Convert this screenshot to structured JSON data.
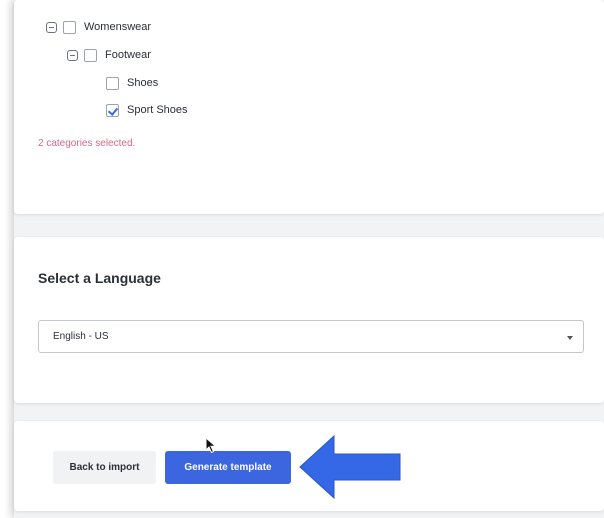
{
  "tree": {
    "items": [
      {
        "label": "Womenswear",
        "checked": false,
        "expandable": true
      },
      {
        "label": "Footwear",
        "checked": false,
        "expandable": true
      },
      {
        "label": "Shoes",
        "checked": false,
        "expandable": false
      },
      {
        "label": "Sport Shoes",
        "checked": true,
        "expandable": false
      }
    ],
    "selected_note": "2 categories selected."
  },
  "language": {
    "title": "Select a Language",
    "selected": "English - US"
  },
  "actions": {
    "back_label": "Back to import",
    "generate_label": "Generate template"
  },
  "colors": {
    "accent": "#3b66e0",
    "annotation_arrow": "#3568e6",
    "note": "#d26a86"
  }
}
